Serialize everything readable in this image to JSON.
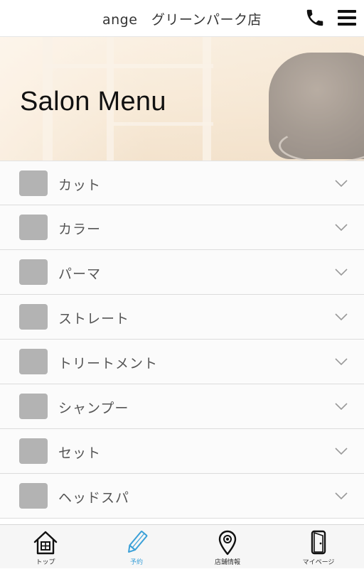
{
  "header": {
    "title": "ange　グリーンパーク店"
  },
  "hero": {
    "title": "Salon Menu"
  },
  "menu": {
    "items": [
      {
        "label": "カット"
      },
      {
        "label": "カラー"
      },
      {
        "label": "パーマ"
      },
      {
        "label": "ストレート"
      },
      {
        "label": "トリートメント"
      },
      {
        "label": "シャンプー"
      },
      {
        "label": "セット"
      },
      {
        "label": "ヘッドスパ"
      }
    ]
  },
  "tabbar": {
    "top_label": "トップ",
    "reserve_label": "予約",
    "shop_label": "店舗情報",
    "mypage_label": "マイページ",
    "active_tab": "reserve",
    "active_color": "#3aa0d8"
  }
}
